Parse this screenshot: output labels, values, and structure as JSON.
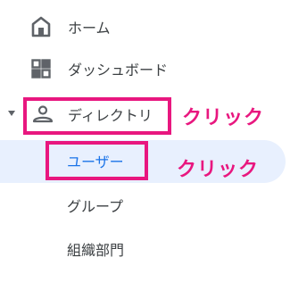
{
  "nav": {
    "items": [
      {
        "label": "ホーム",
        "icon": "home-icon"
      },
      {
        "label": "ダッシュボード",
        "icon": "dashboard-icon"
      },
      {
        "label": "ディレクトリ",
        "icon": "person-icon",
        "expanded": true
      },
      {
        "label": "ユーザー",
        "selected": true
      },
      {
        "label": "グループ"
      },
      {
        "label": "組織部門"
      }
    ]
  },
  "annotations": {
    "directory_callout": "クリック",
    "users_callout": "クリック"
  },
  "colors": {
    "highlight": "#e8177f",
    "active_bg": "#e8f0fe",
    "active_text": "#1a73e8",
    "text": "#3c4043",
    "icon": "#5f6368"
  }
}
